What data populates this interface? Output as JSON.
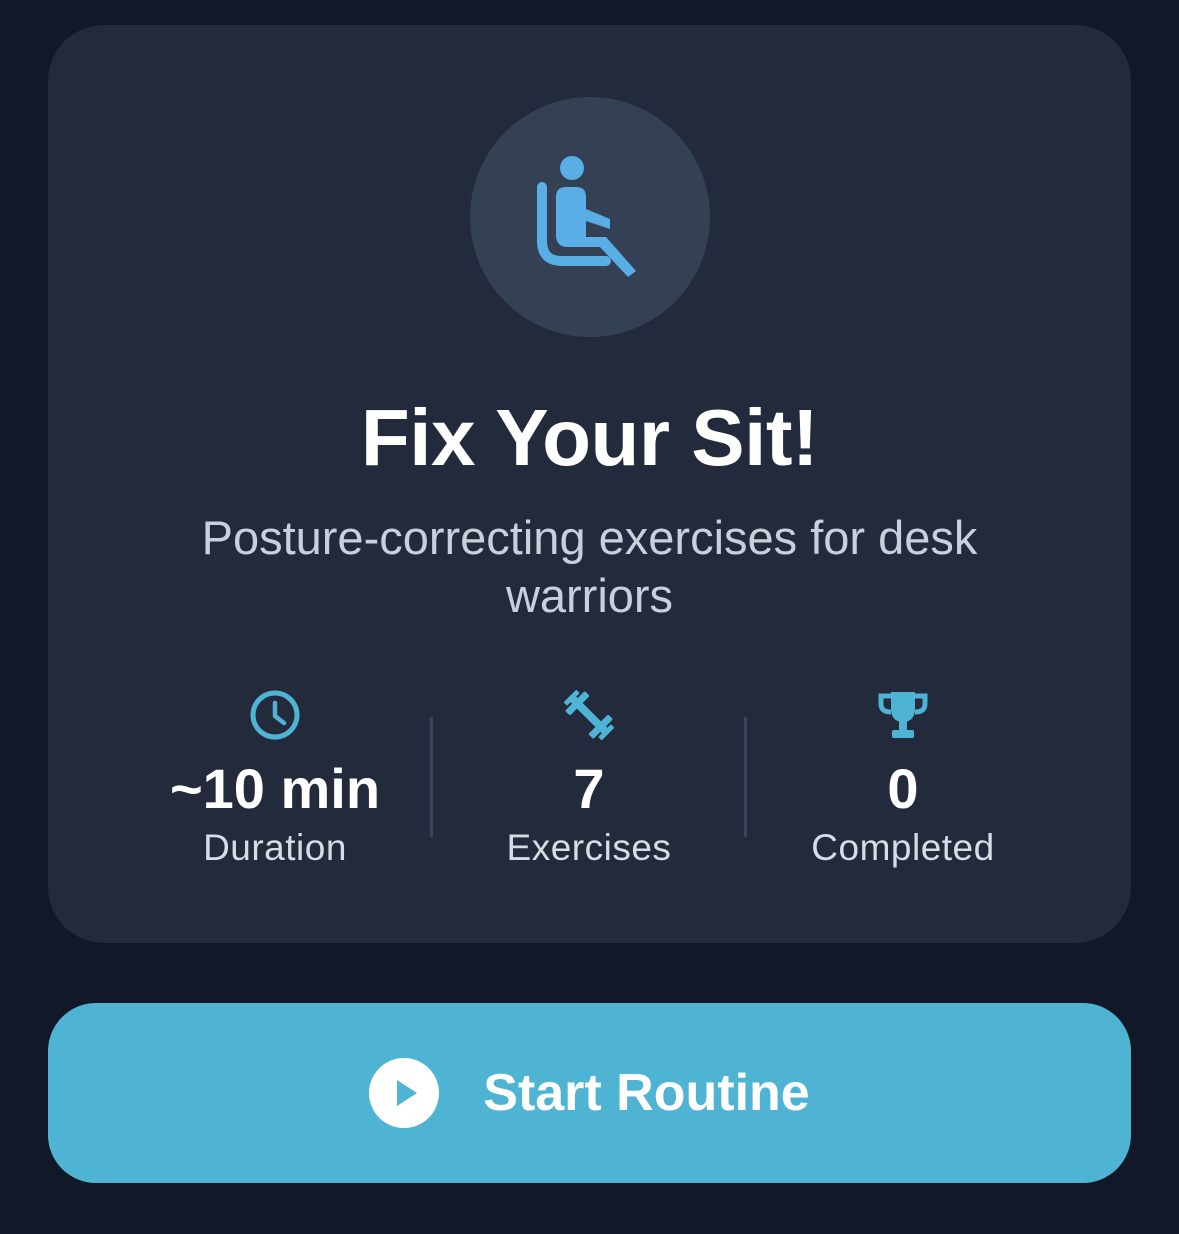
{
  "card": {
    "hero_icon": "seated-person-icon",
    "title": "Fix Your Sit!",
    "subtitle": "Posture-correcting exercises for desk warriors"
  },
  "stats": [
    {
      "icon": "clock-icon",
      "value": "~10 min",
      "label": "Duration"
    },
    {
      "icon": "dumbbell-icon",
      "value": "7",
      "label": "Exercises"
    },
    {
      "icon": "trophy-icon",
      "value": "0",
      "label": "Completed"
    }
  ],
  "start_button": {
    "icon": "play-icon",
    "label": "Start Routine"
  },
  "colors": {
    "background": "#111827",
    "card": "#222a3b",
    "hero_circle": "#344154",
    "accent": "#4fb3d3",
    "icon_blue": "#5aaee6"
  }
}
